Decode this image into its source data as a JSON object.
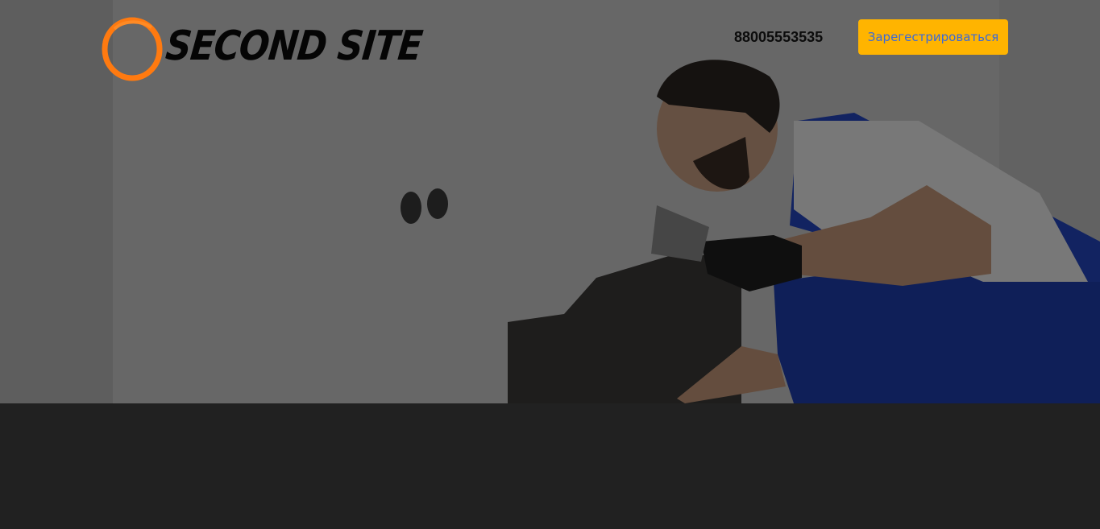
{
  "header": {
    "logo_text": "SECOND SITE",
    "phone": "88005553535",
    "register_label": "Зарегестрироваться"
  },
  "colors": {
    "accent_button": "#ffb400",
    "button_text": "#3b6ad8",
    "logo_ring": "#ff7a10",
    "page_background": "#212121"
  },
  "hero": {
    "image": "worker-plastering-wall-photo"
  }
}
